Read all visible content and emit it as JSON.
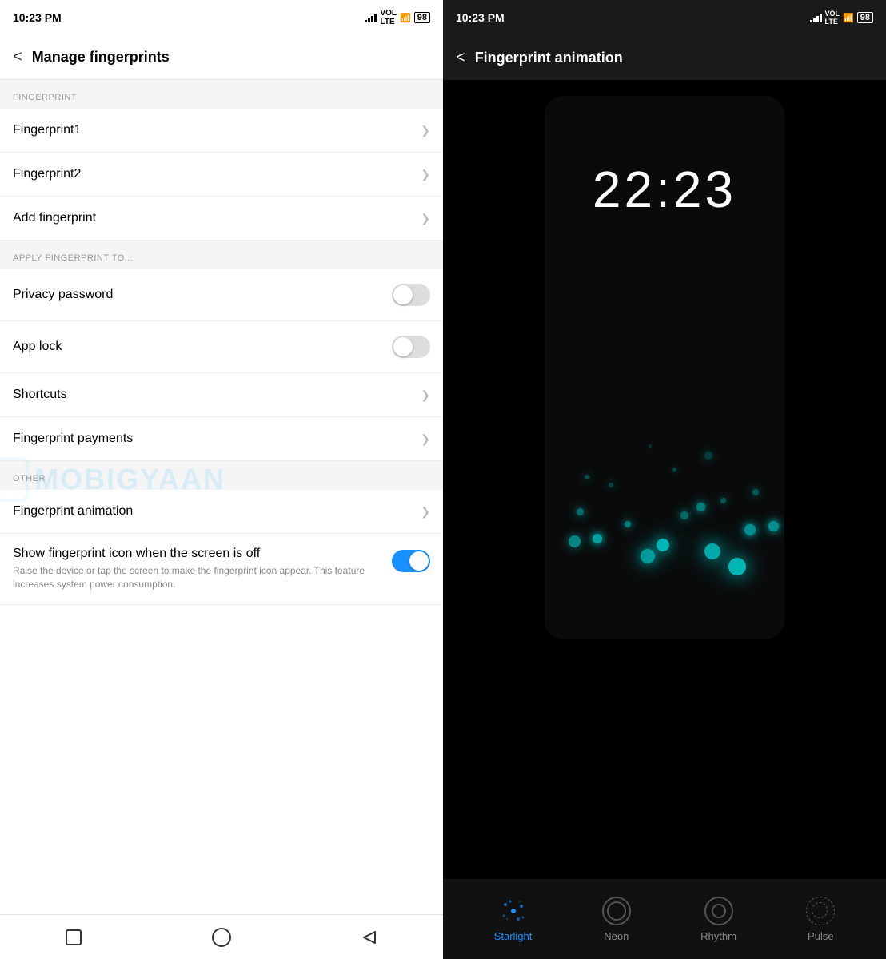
{
  "left": {
    "statusBar": {
      "time": "10:23 PM",
      "battery": "98"
    },
    "title": "Manage fingerprints",
    "sections": {
      "fingerprint": {
        "label": "FINGERPRINT",
        "items": [
          {
            "id": "fp1",
            "text": "Fingerprint1",
            "type": "nav"
          },
          {
            "id": "fp2",
            "text": "Fingerprint2",
            "type": "nav"
          },
          {
            "id": "add",
            "text": "Add fingerprint",
            "type": "nav"
          }
        ]
      },
      "applyTo": {
        "label": "APPLY FINGERPRINT TO...",
        "items": [
          {
            "id": "privacy",
            "text": "Privacy password",
            "type": "toggle",
            "value": false
          },
          {
            "id": "applock",
            "text": "App lock",
            "type": "toggle",
            "value": false
          },
          {
            "id": "shortcuts",
            "text": "Shortcuts",
            "type": "nav"
          },
          {
            "id": "payments",
            "text": "Fingerprint payments",
            "type": "nav"
          }
        ]
      },
      "other": {
        "label": "OTHER",
        "items": [
          {
            "id": "animation",
            "text": "Fingerprint animation",
            "type": "nav"
          }
        ]
      }
    },
    "showFingerprintIcon": {
      "title": "Show fingerprint icon when the screen is off",
      "subtitle": "Raise the device or tap the screen to make the fingerprint icon appear. This feature increases system power consumption.",
      "value": true
    }
  },
  "right": {
    "statusBar": {
      "time": "10:23 PM",
      "battery": "98"
    },
    "title": "Fingerprint animation",
    "previewTime": "22:23",
    "tabs": [
      {
        "id": "starlight",
        "label": "Starlight",
        "active": true
      },
      {
        "id": "neon",
        "label": "Neon",
        "active": false
      },
      {
        "id": "rhythm",
        "label": "Rhythm",
        "active": false
      },
      {
        "id": "pulse",
        "label": "Pulse",
        "active": false
      }
    ]
  },
  "watermark": "MOBIGYAAN"
}
